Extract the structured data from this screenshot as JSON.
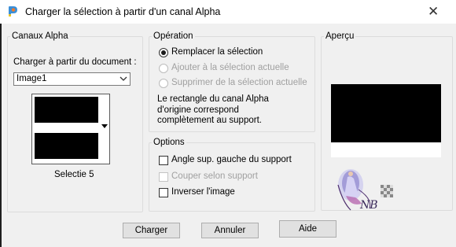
{
  "window": {
    "title": "Charger la sélection à partir d'un canal Alpha",
    "close_label": "✕"
  },
  "canaux": {
    "legend": "Canaux Alpha",
    "load_label": "Charger à partir du document :",
    "document_value": "Image1",
    "channel_name": "Selectie 5"
  },
  "operation": {
    "legend": "Opération",
    "options": [
      {
        "label": "Remplacer la sélection",
        "selected": true,
        "enabled": true
      },
      {
        "label": "Ajouter à la sélection actuelle",
        "selected": false,
        "enabled": false
      },
      {
        "label": "Supprimer de la sélection actuelle",
        "selected": false,
        "enabled": false
      }
    ],
    "description": [
      "Le rectangle du canal Alpha",
      "d'origine correspond",
      "complètement au support."
    ]
  },
  "options": {
    "legend": "Options",
    "items": [
      {
        "label": "Angle sup. gauche du support",
        "checked": false,
        "enabled": true
      },
      {
        "label": "Couper selon support",
        "checked": false,
        "enabled": false
      },
      {
        "label": "Inverser l'image",
        "checked": false,
        "enabled": true
      }
    ]
  },
  "apercu": {
    "legend": "Aperçu",
    "watermark_text": "NB"
  },
  "buttons": {
    "charger": "Charger",
    "annuler": "Annuler",
    "aide": "Aide"
  },
  "icons": {
    "app": "paint-shop-pro-icon",
    "close": "close-icon",
    "dropdown": "chevron-down-icon"
  },
  "colors": {
    "background": "#f0f0f0",
    "mask_black": "#000000",
    "mask_white": "#ffffff"
  }
}
